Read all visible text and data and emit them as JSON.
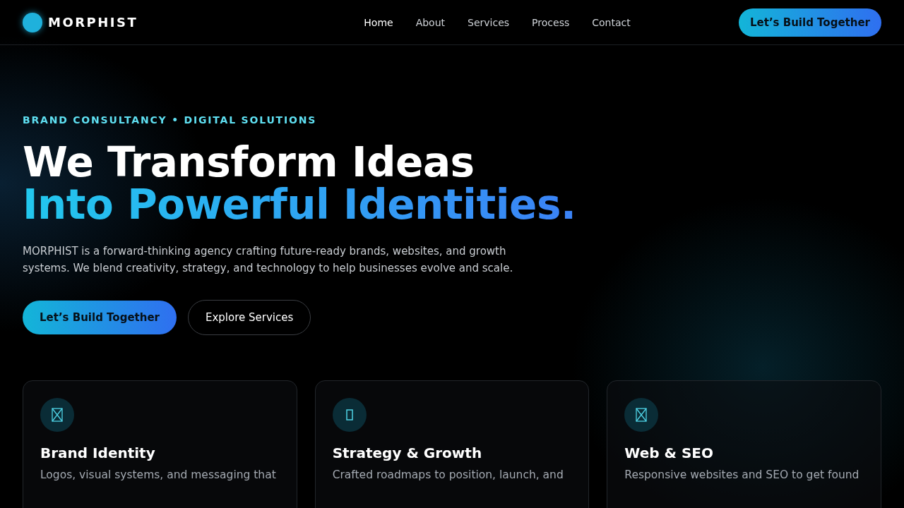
{
  "brand": {
    "name": "MORPHIST"
  },
  "nav": [
    {
      "label": "Home",
      "selected": true
    },
    {
      "label": "About",
      "selected": false
    },
    {
      "label": "Services",
      "selected": false
    },
    {
      "label": "Process",
      "selected": false
    },
    {
      "label": "Contact",
      "selected": false
    }
  ],
  "header_cta": "Let’s Build Together",
  "hero": {
    "eyebrow": "BRAND CONSULTANCY • DIGITAL SOLUTIONS",
    "headline": "We Transform Ideas",
    "headline_accent": "Into Powerful Identities.",
    "body": "MORPHIST is a forward-thinking agency crafting future-ready brands, websites, and growth systems. We blend creativity, strategy, and technology to help businesses evolve and scale.",
    "buttons": [
      {
        "label": "Let’s Build Together",
        "kind": "primary"
      },
      {
        "label": "Explore Services",
        "kind": "outline"
      }
    ]
  },
  "cards": [
    {
      "title": "Brand Identity",
      "description": "Logos, visual systems, and messaging that",
      "kind": "crossed"
    },
    {
      "title": "Strategy & Growth",
      "description": "Crafted roadmaps to position, launch, and",
      "kind": "empty"
    },
    {
      "title": "Web & SEO",
      "description": "Responsive websites and SEO to get found",
      "kind": "crossed"
    }
  ]
}
